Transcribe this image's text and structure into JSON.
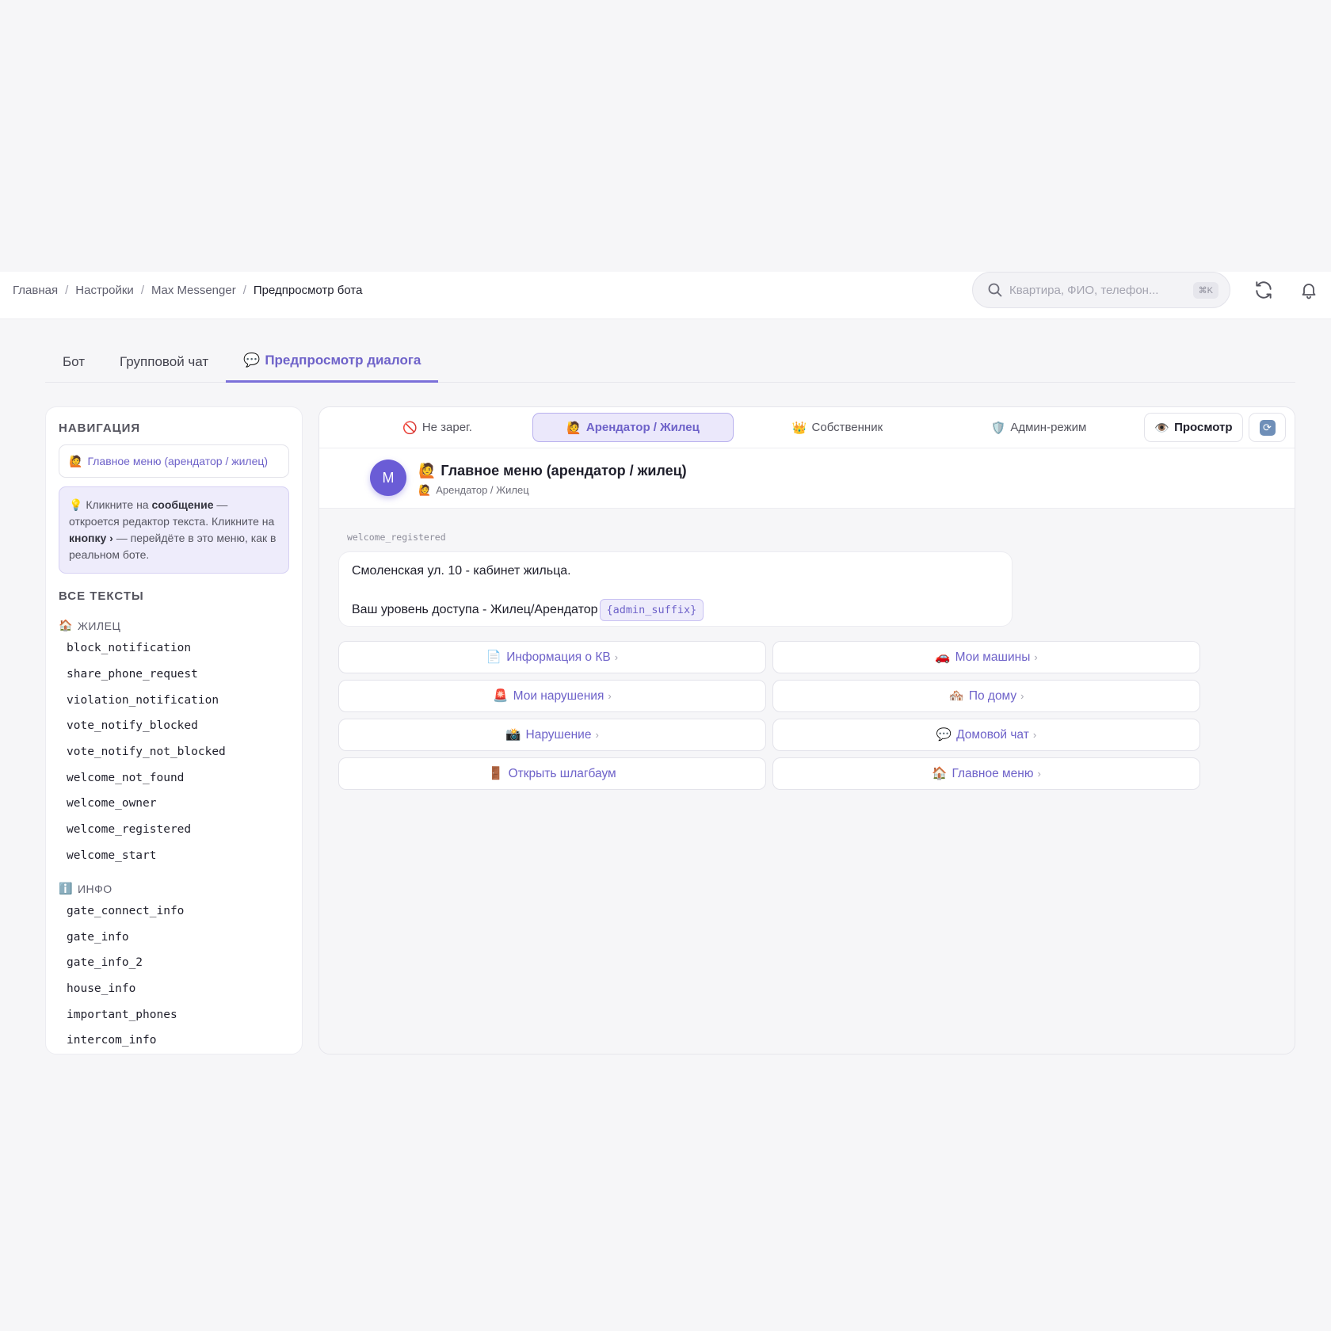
{
  "breadcrumb": {
    "items": [
      "Главная",
      "Настройки",
      "Max Messenger"
    ],
    "current": "Предпросмотр бота",
    "separator": "/"
  },
  "search": {
    "placeholder": "Квартира, ФИО, телефон...",
    "shortcut": "⌘K"
  },
  "header_icons": [
    "refresh-icon",
    "bell-icon"
  ],
  "tabs": [
    {
      "emoji": "",
      "label": "Бот"
    },
    {
      "emoji": "",
      "label": "Групповой чат"
    },
    {
      "emoji": "💬",
      "label": "Предпросмотр диалога",
      "active": true
    }
  ],
  "sidebar": {
    "nav_title": "НАВИГАЦИЯ",
    "nav_item": {
      "emoji": "🙋",
      "label": "Главное меню (арендатор / жилец)"
    },
    "hint": {
      "emoji": "💡",
      "t1": "Кликните на ",
      "b1": "сообщение",
      "t2": " — откроется редактор текста. Кликните на ",
      "b2": "кнопку ›",
      "t3": " — перейдёте в это меню, как в реальном боте."
    },
    "all_title": "ВСЕ ТЕКСТЫ",
    "groups": [
      {
        "emoji": "🏠",
        "label": "ЖИЛЕЦ",
        "keys": [
          "block_notification",
          "share_phone_request",
          "violation_notification",
          "vote_notify_blocked",
          "vote_notify_not_blocked",
          "welcome_not_found",
          "welcome_owner",
          "welcome_registered",
          "welcome_start"
        ]
      },
      {
        "emoji": "ℹ️",
        "label": "ИНФО",
        "keys": [
          "gate_connect_info",
          "gate_info",
          "gate_info_2",
          "house_info",
          "important_phones",
          "intercom_info"
        ]
      }
    ]
  },
  "roles": [
    {
      "emoji": "🚫",
      "label": "Не зарег."
    },
    {
      "emoji": "🙋",
      "label": "Арендатор / Жилец",
      "active": true
    },
    {
      "emoji": "👑",
      "label": "Собственник"
    },
    {
      "emoji": "🛡️",
      "label": "Админ-режим"
    }
  ],
  "view_button": {
    "emoji": "👁️",
    "label": "Просмотр"
  },
  "chat": {
    "avatar_letter": "M",
    "title_emoji": "🙋",
    "title": "Главное меню (арендатор / жилец)",
    "subtitle_emoji": "🙋",
    "subtitle": "Арендатор / Жилец",
    "message_key": "welcome_registered",
    "message_line1": "Смоленская ул. 10 - кабинет жильца.",
    "message_line2": "Ваш уровень доступа - Жилец/Арендатор",
    "message_var": "{admin_suffix}"
  },
  "keyboard": [
    {
      "emoji": "📄",
      "label": "Информация о КВ"
    },
    {
      "emoji": "🚗",
      "label": "Мои машины"
    },
    {
      "emoji": "🚨",
      "label": "Мои нарушения"
    },
    {
      "emoji": "🏘️",
      "label": "По дому"
    },
    {
      "emoji": "📸",
      "label": "Нарушение"
    },
    {
      "emoji": "💬",
      "label": "Домовой чат"
    },
    {
      "emoji": "🚪",
      "label": "Открыть шлагбаум"
    },
    {
      "emoji": "🏠",
      "label": "Главное меню"
    }
  ],
  "chevron": "›",
  "colors": {
    "accent": "#6e62c9",
    "accent_light": "#eeecfb",
    "avatar": "#6a5cd6",
    "background": "#f6f6f8"
  }
}
